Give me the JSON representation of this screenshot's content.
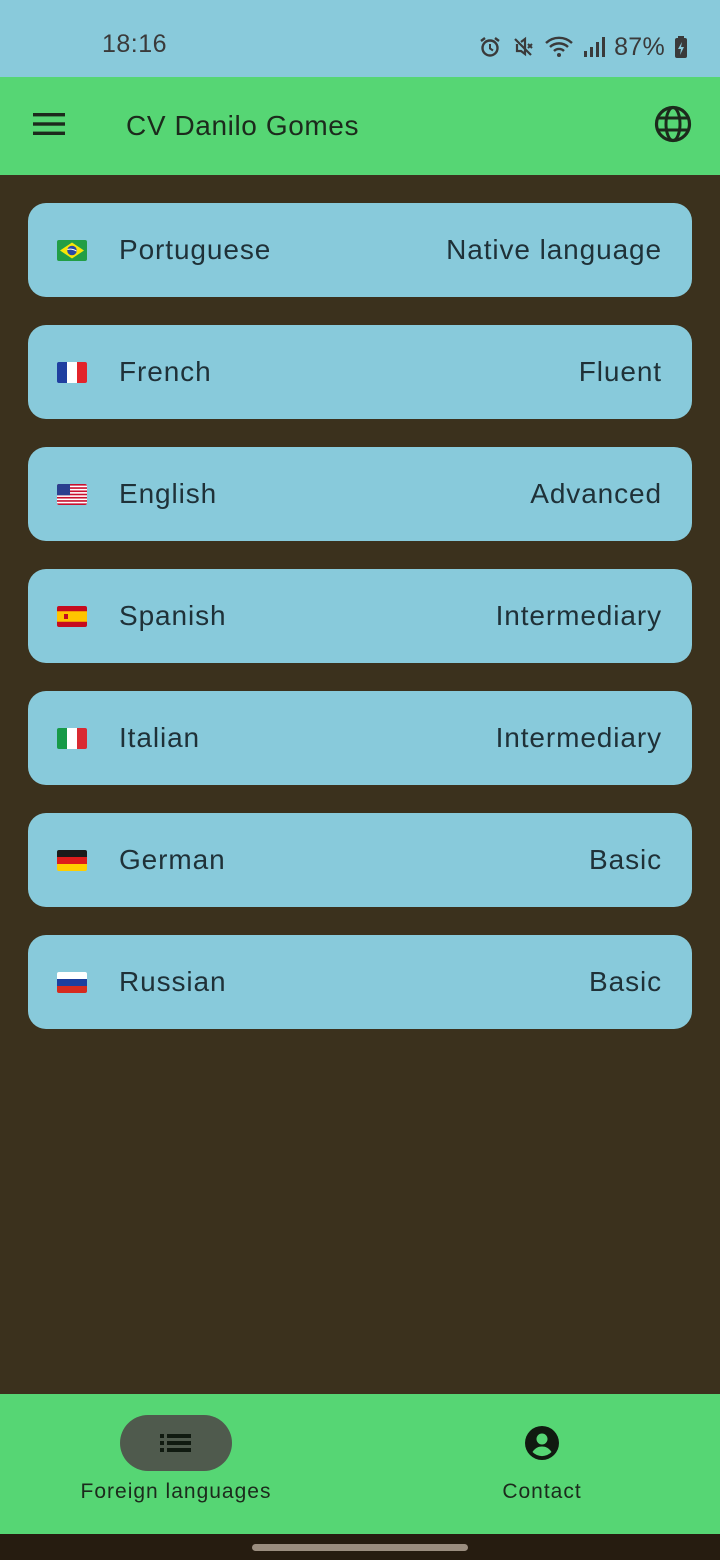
{
  "status_bar": {
    "time": "18:16",
    "battery": "87%",
    "icons": [
      "alarm-icon",
      "vibrate-off-icon",
      "wifi-icon",
      "signal-icon",
      "battery-charging-icon"
    ]
  },
  "app_bar": {
    "title": "CV Danilo Gomes",
    "menu_icon": "menu-icon",
    "action_icon": "globe-icon"
  },
  "languages": [
    {
      "flag": "brazil-flag-icon",
      "name": "Portuguese",
      "level": "Native language"
    },
    {
      "flag": "france-flag-icon",
      "name": "French",
      "level": "Fluent"
    },
    {
      "flag": "usa-flag-icon",
      "name": "English",
      "level": "Advanced"
    },
    {
      "flag": "spain-flag-icon",
      "name": "Spanish",
      "level": "Intermediary"
    },
    {
      "flag": "italy-flag-icon",
      "name": "Italian",
      "level": "Intermediary"
    },
    {
      "flag": "germany-flag-icon",
      "name": "German",
      "level": "Basic"
    },
    {
      "flag": "russia-flag-icon",
      "name": "Russian",
      "level": "Basic"
    }
  ],
  "bottom_nav": {
    "items": [
      {
        "label": "Foreign languages",
        "icon": "list-icon",
        "selected": true
      },
      {
        "label": "Contact",
        "icon": "account-circle-icon",
        "selected": false
      }
    ]
  },
  "colors": {
    "status_bar": "#89cadb",
    "app_bar": "#56d674",
    "background": "#3b311d",
    "card": "#88cadb",
    "nav_indicator": "#4f5a4d"
  }
}
